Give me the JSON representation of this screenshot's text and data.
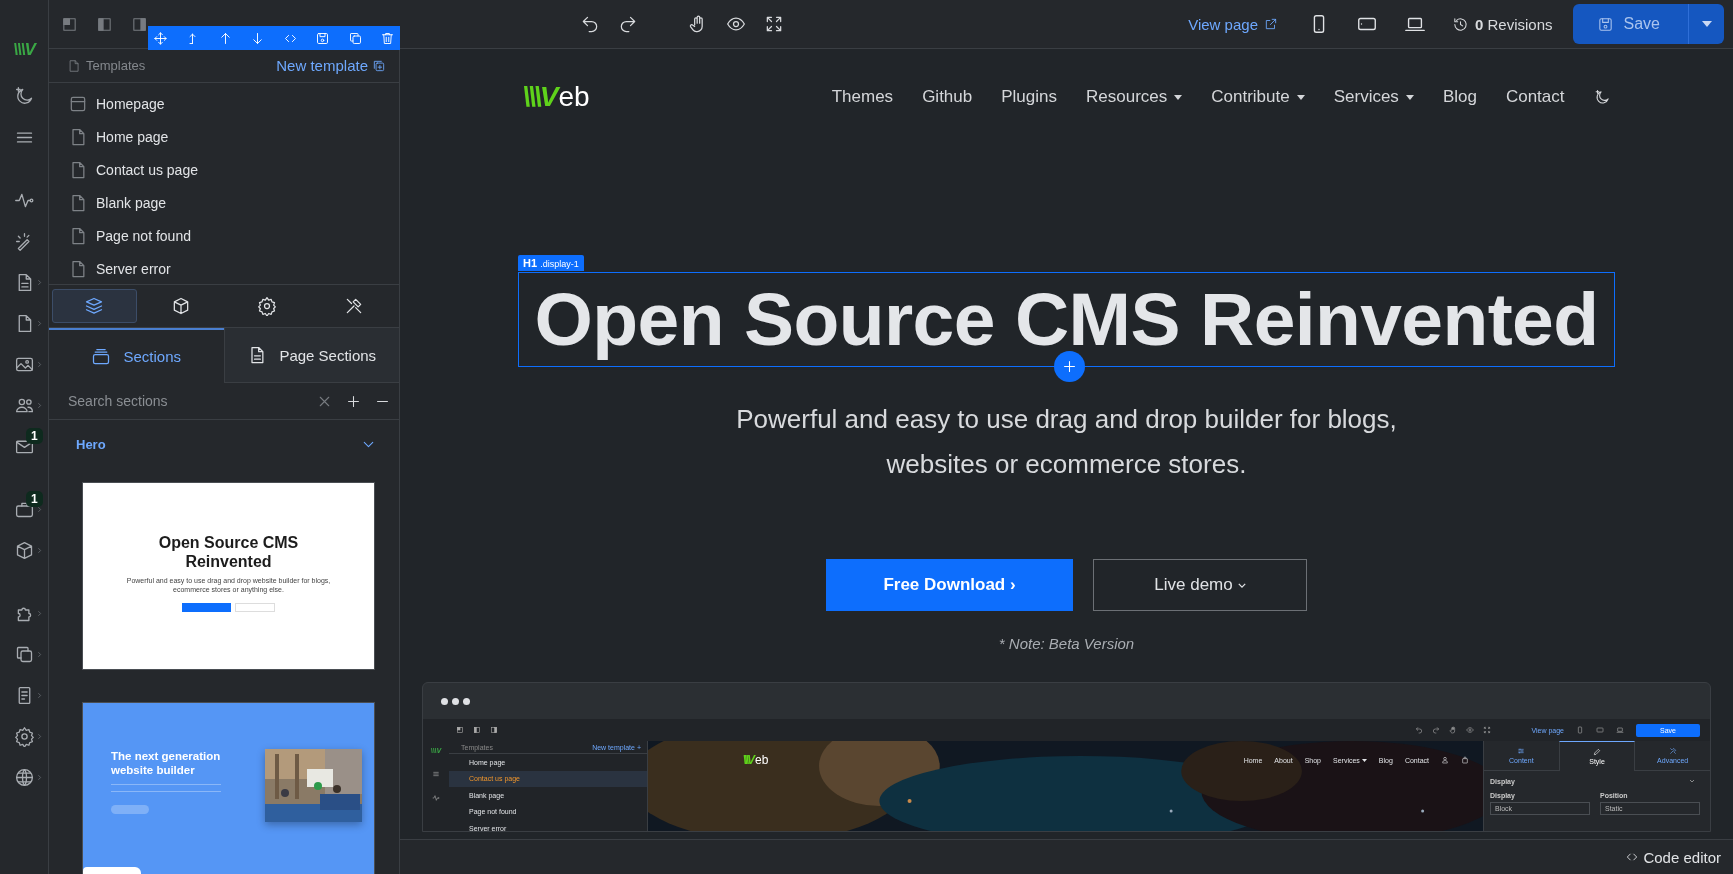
{
  "rail": {
    "logo_mark": "\\\\\\V",
    "groups": [
      [
        {
          "submenu": false
        },
        {
          "submenu": false
        }
      ],
      [
        {
          "submenu": false
        },
        {
          "submenu": false
        },
        {
          "submenu": true
        },
        {
          "submenu": true
        },
        {
          "submenu": true
        },
        {
          "submenu": true
        },
        {
          "submenu": false,
          "badge": "1"
        }
      ],
      [
        {
          "submenu": true,
          "badge": "1"
        },
        {
          "submenu": true
        }
      ],
      [
        {
          "submenu": true
        },
        {
          "submenu": true
        },
        {
          "submenu": true
        },
        {
          "submenu": true
        },
        {
          "submenu": true
        }
      ]
    ]
  },
  "topbar": {
    "view_page": "View page",
    "revisions": "**0** Revisions",
    "save": "Save"
  },
  "templates": {
    "title": "Templates",
    "new_template": "New template",
    "items": [
      {
        "label": "Homepage",
        "kind": "home"
      },
      {
        "label": "Home page",
        "kind": "page"
      },
      {
        "label": "Contact us page",
        "kind": "page"
      },
      {
        "label": "Blank page",
        "kind": "page"
      },
      {
        "label": "Page not found",
        "kind": "page"
      },
      {
        "label": "Server error",
        "kind": "page"
      }
    ]
  },
  "panel_tabs": [
    {
      "selected": true
    },
    {
      "selected": false
    },
    {
      "selected": false
    },
    {
      "selected": false
    }
  ],
  "section_tabs": [
    {
      "label": "Sections",
      "selected": true
    },
    {
      "label": "Page Sections",
      "selected": false
    }
  ],
  "search": {
    "placeholder": "Search sections"
  },
  "group": {
    "title": "Hero",
    "expanded": true
  },
  "thumbnails": [
    {
      "kind": "light",
      "title": "Open Source CMS Reinvented",
      "text": "Powerful and easy to use drag and drop website builder for blogs, ecommerce stores or anything else."
    },
    {
      "kind": "blue",
      "title": "The next generation website builder"
    }
  ],
  "site": {
    "logo_mark": "\\\\\\V",
    "logo_text": "eb",
    "nav": [
      {
        "label": "Themes",
        "dropdown": false
      },
      {
        "label": "Github",
        "dropdown": false
      },
      {
        "label": "Plugins",
        "dropdown": false
      },
      {
        "label": "Resources",
        "dropdown": true
      },
      {
        "label": "Contribute",
        "dropdown": true
      },
      {
        "label": "Services",
        "dropdown": true
      },
      {
        "label": "Blog",
        "dropdown": false
      },
      {
        "label": "Contact",
        "dropdown": false
      }
    ],
    "selection_tag": "H1",
    "selection_class": ".display-1",
    "heading": "Open Source CMS Reinvented",
    "lead": "Powerful and easy to use drag and drop builder for blogs, websites or ecommerce stores.",
    "primary": "Free Download ›",
    "secondary": "Live demo",
    "note": "* Note: Beta Version"
  },
  "preview": {
    "templates_title": "Templates",
    "new_template": "New template +",
    "items": [
      {
        "label": "Home page",
        "selected": false
      },
      {
        "label": "Contact us page",
        "selected": true
      },
      {
        "label": "Blank page",
        "selected": false
      },
      {
        "label": "Page not found",
        "selected": false
      },
      {
        "label": "Server error",
        "selected": false
      }
    ],
    "view_page": "View page",
    "save": "Save",
    "rail_mark": "\\\\\\V",
    "logo_mark": "\\\\\\V",
    "logo_text": "eb",
    "nav": [
      {
        "label": "Home",
        "dropdown": false
      },
      {
        "label": "About",
        "dropdown": false
      },
      {
        "label": "Shop",
        "dropdown": false
      },
      {
        "label": "Services",
        "dropdown": true
      },
      {
        "label": "Blog",
        "dropdown": false
      },
      {
        "label": "Contact",
        "dropdown": false
      }
    ],
    "tabs": [
      {
        "label": "Content",
        "selected": false
      },
      {
        "label": "Style",
        "selected": true
      },
      {
        "label": "Advanced",
        "selected": false
      }
    ],
    "section": "Display",
    "fields": [
      {
        "label": "Display",
        "value": "Block"
      },
      {
        "label": "Position",
        "value": "Static"
      }
    ]
  },
  "footer": {
    "code_editor": "Code editor"
  }
}
